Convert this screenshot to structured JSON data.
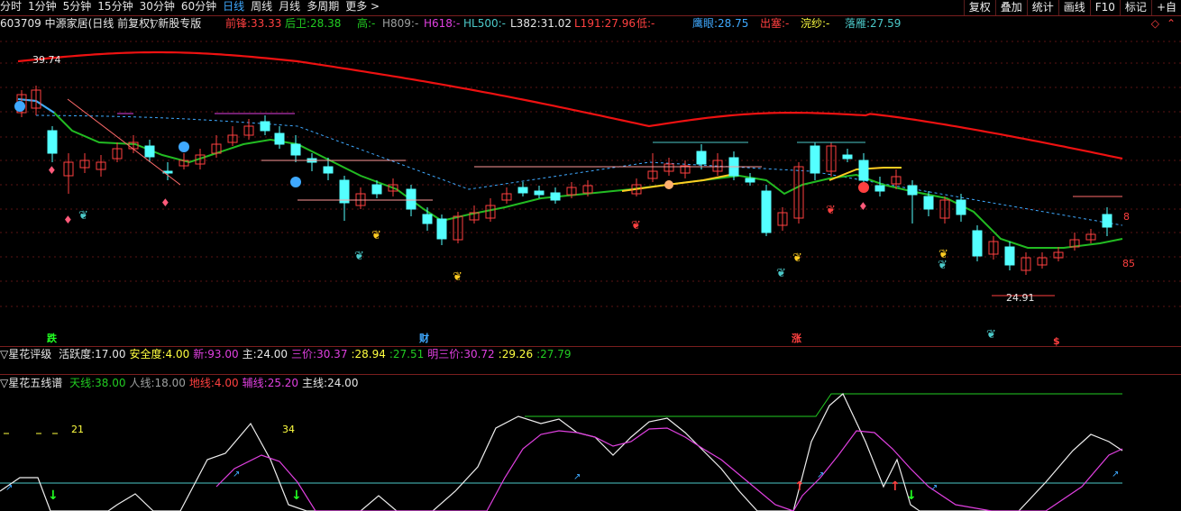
{
  "toolbar": {
    "timeframes": [
      "分时",
      "1分钟",
      "5分钟",
      "15分钟",
      "30分钟",
      "60分钟",
      "日线",
      "周线",
      "月线",
      "多周期",
      "更多 >"
    ],
    "active_timeframe": "日线",
    "right_buttons": [
      "复权",
      "叠加",
      "统计",
      "画线",
      "F10",
      "标记",
      "+自"
    ]
  },
  "info": {
    "stock_title": "603709 中源家居(日线 前复权)",
    "template": "▽新股专版",
    "items": [
      {
        "label": "前锋:",
        "value": "33.33",
        "color": "#ff4040"
      },
      {
        "label": "后卫:",
        "value": "28.38",
        "color": "#22cc22"
      },
      {
        "label": "高:",
        "value": "-",
        "color": "#22cc22"
      },
      {
        "label": "H809:",
        "value": "-",
        "color": "#9ea0a0"
      },
      {
        "label": "H618:",
        "value": "-",
        "color": "#e040e0"
      },
      {
        "label": "HL500:",
        "value": "-",
        "color": "#4cc9c9"
      },
      {
        "label": "L382:",
        "value": "31.02",
        "color": "#e6e6e6"
      },
      {
        "label": "L191:",
        "value": "27.96",
        "color": "#ff4040"
      },
      {
        "label": "低:",
        "value": "-",
        "color": "#ff4040"
      },
      {
        "label": "鹰眼:",
        "value": "28.75",
        "color": "#3fa9ff"
      },
      {
        "label": "出塞:",
        "value": "-",
        "color": "#ff4040"
      },
      {
        "label": "浣纱:",
        "value": "-",
        "color": "#ffff40"
      },
      {
        "label": "落雁:",
        "value": "27.59",
        "color": "#4cc9c9"
      }
    ]
  },
  "main_chart": {
    "high_label": "39.74",
    "low_label": "24.91",
    "right_label_top": "8",
    "right_label_bottom": "85",
    "event_markers": [
      {
        "text": "跌",
        "color": "#22ff22"
      },
      {
        "text": "财",
        "color": "#3fa9ff"
      },
      {
        "text": "涨",
        "color": "#ff4040"
      },
      {
        "text": "$",
        "color": "#ff4040"
      }
    ]
  },
  "indicator1": {
    "title": "▽星花评级",
    "items": [
      {
        "label": "活跃度:",
        "value": "17.00",
        "color": "#e6e6e6"
      },
      {
        "label": "安全度:",
        "value": "4.00",
        "color": "#ffff40"
      },
      {
        "label": "新:",
        "value": "93.00",
        "color": "#e040e0"
      },
      {
        "label": "主:",
        "value": "24.00",
        "color": "#e6e6e6"
      },
      {
        "label": "三价:",
        "value": "30.37",
        "color": "#e040e0"
      },
      {
        "label": ":",
        "value": "28.94",
        "color": "#ffff40"
      },
      {
        "label": ":",
        "value": "27.51",
        "color": "#22cc22"
      },
      {
        "label": "明三价:",
        "value": "30.72",
        "color": "#e040e0"
      },
      {
        "label": ":",
        "value": "29.26",
        "color": "#ffff40"
      },
      {
        "label": ":",
        "value": "27.79",
        "color": "#22cc22"
      }
    ]
  },
  "indicator2": {
    "title": "▽星花五线谱",
    "items": [
      {
        "label": "天线:",
        "value": "38.00",
        "color": "#22cc22"
      },
      {
        "label": "人线:",
        "value": "18.00",
        "color": "#9ea0a0"
      },
      {
        "label": "地线:",
        "value": "4.00",
        "color": "#ff4040"
      },
      {
        "label": "辅线:",
        "value": "25.20",
        "color": "#e040e0"
      },
      {
        "label": "主线:",
        "value": "24.00",
        "color": "#e6e6e6"
      }
    ],
    "label_21": "21",
    "label_34": "34"
  },
  "colors": {
    "up": "#ff4040",
    "down": "#54ffff",
    "red_line": "#ee1111",
    "green_line": "#22bb22",
    "blue_dash": "#3fa9ff",
    "accent": "#3fa9ff"
  }
}
